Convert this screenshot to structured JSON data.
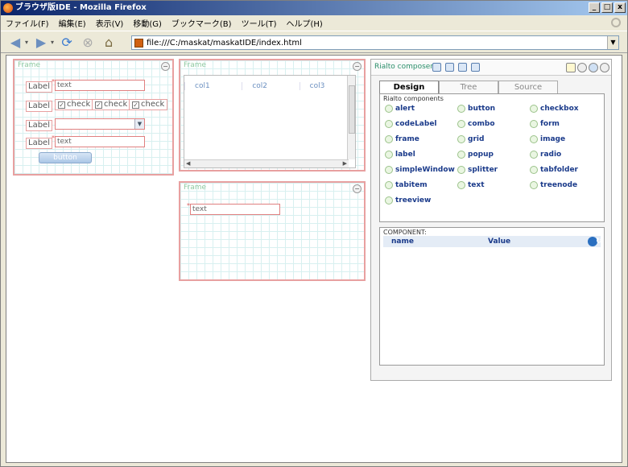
{
  "window": {
    "title": "ブラウザ版IDE - Mozilla Firefox",
    "btn_min": "_",
    "btn_max": "□",
    "btn_close": "x"
  },
  "menu": [
    {
      "label": "ファイル(F)"
    },
    {
      "label": "編集(E)"
    },
    {
      "label": "表示(V)"
    },
    {
      "label": "移動(G)"
    },
    {
      "label": "ブックマーク(B)"
    },
    {
      "label": "ツール(T)"
    },
    {
      "label": "ヘルプ(H)"
    }
  ],
  "nav": {
    "url": "file:///C:/maskat/maskatIDE/index.html"
  },
  "frame1": {
    "title": "Frame",
    "label1": "Label",
    "text1": "text",
    "label2": "Label",
    "check1": "check",
    "check2": "check",
    "check3": "check",
    "label3": "Label",
    "label4": "Label",
    "text2": "text",
    "button": "button"
  },
  "frame2": {
    "title": "Frame",
    "columns": [
      "col1",
      "col2",
      "col3"
    ]
  },
  "frame3": {
    "title": "Frame",
    "text": "text"
  },
  "composer": {
    "title": "Rialto composer",
    "tabs": [
      {
        "label": "Design"
      },
      {
        "label": "Tree"
      },
      {
        "label": "Source"
      }
    ],
    "components_title": "Rialto components",
    "components": [
      "alert",
      "button",
      "checkbox",
      "codeLabel",
      "combo",
      "form",
      "frame",
      "grid",
      "image",
      "label",
      "popup",
      "radio",
      "simpleWindow",
      "splitter",
      "tabfolder",
      "tabitem",
      "text",
      "treenode",
      "treeview"
    ],
    "component_title": "COMPONENT:",
    "col_name": "name",
    "col_value": "Value"
  }
}
